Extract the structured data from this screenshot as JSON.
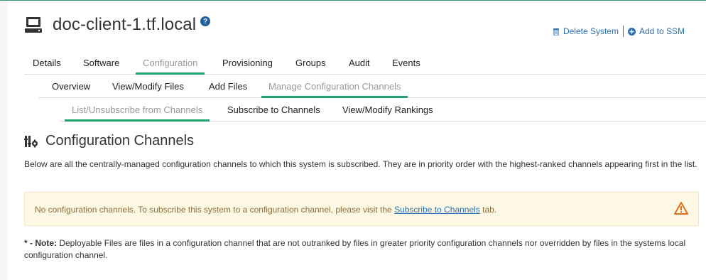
{
  "system": {
    "title": "doc-client-1.tf.local",
    "help_glyph": "?"
  },
  "actions": {
    "delete": "Delete System",
    "add_ssm": "Add to SSM"
  },
  "tabs_primary": [
    {
      "label": "Details",
      "active": false
    },
    {
      "label": "Software",
      "active": false
    },
    {
      "label": "Configuration",
      "active": true
    },
    {
      "label": "Provisioning",
      "active": false
    },
    {
      "label": "Groups",
      "active": false
    },
    {
      "label": "Audit",
      "active": false
    },
    {
      "label": "Events",
      "active": false
    }
  ],
  "tabs_secondary": [
    {
      "label": "Overview",
      "active": false
    },
    {
      "label": "View/Modify Files",
      "active": false
    },
    {
      "label": "Add Files",
      "active": false
    },
    {
      "label": "Manage Configuration Channels",
      "active": true
    }
  ],
  "tabs_tertiary": [
    {
      "label": "List/Unsubscribe from Channels",
      "active": true
    },
    {
      "label": "Subscribe to Channels",
      "active": false
    },
    {
      "label": "View/Modify Rankings",
      "active": false
    }
  ],
  "section": {
    "heading": "Configuration Channels",
    "description": "Below are all the centrally-managed configuration channels to which this system is subscribed. They are in priority order with the highest-ranked channels appearing first in the list."
  },
  "alert": {
    "text_before": "No configuration channels. To subscribe this system to a configuration channel, please visit the ",
    "link": "Subscribe to Channels",
    "text_after": " tab."
  },
  "note": {
    "prefix": "* - Note:",
    "text": " Deployable Files are files in a configuration channel that are not outranked by files in greater priority configuration channels nor overridden by files in the systems local configuration channel."
  },
  "colors": {
    "accent": "#20a36d",
    "link": "#2a6fb0",
    "alert_bg": "#fcf8e3",
    "warning": "#e0701e"
  }
}
